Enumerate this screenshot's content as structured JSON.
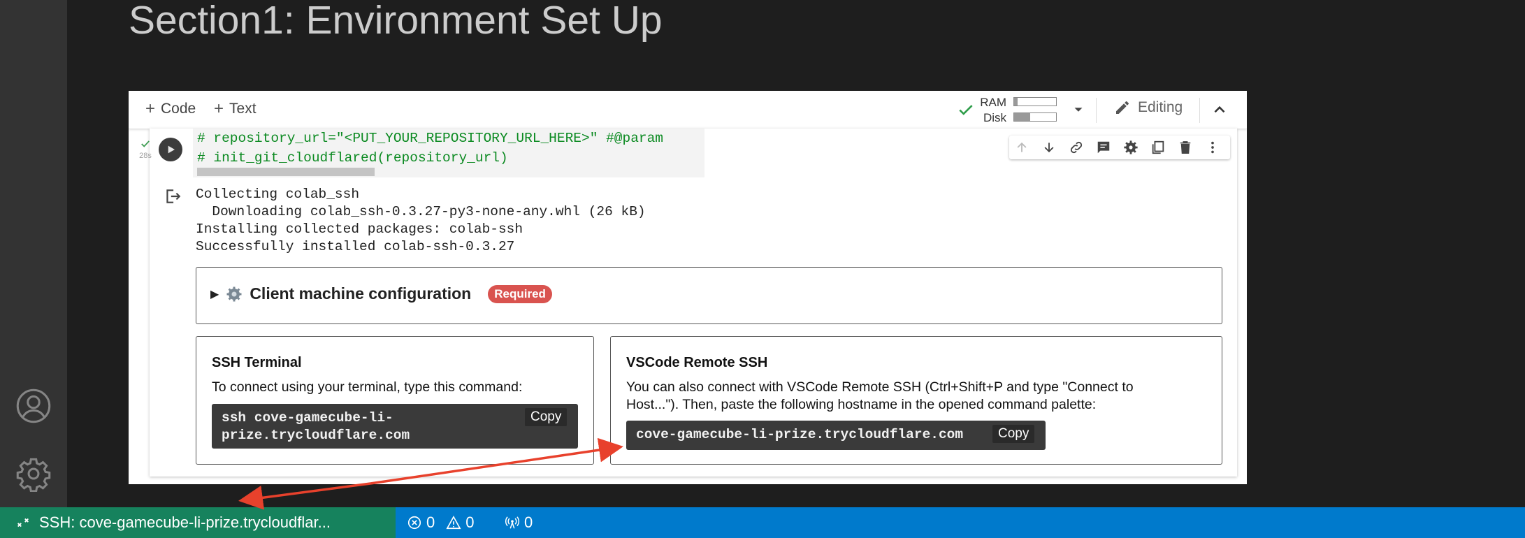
{
  "page": {
    "section_title": "Section1: Environment Set Up"
  },
  "activity_bar": {
    "icons": [
      "account-icon",
      "settings-gear-icon"
    ]
  },
  "colab": {
    "toolbar": {
      "add_code_label": "Code",
      "add_text_label": "Text",
      "ram_label": "RAM",
      "disk_label": "Disk",
      "ram_usage": 0.08,
      "disk_usage": 0.38,
      "editing_label": "Editing"
    },
    "cell": {
      "exec_time": "28s",
      "code_lines": [
        "# repository_url=\"<PUT_YOUR_REPOSITORY_URL_HERE>\" #@param",
        "# init_git_cloudflared(repository_url)"
      ],
      "output_lines": [
        "Collecting colab_ssh",
        "  Downloading colab_ssh-0.3.27-py3-none-any.whl (26 kB)",
        "Installing collected packages: colab-ssh",
        "Successfully installed colab-ssh-0.3.27"
      ],
      "tools": [
        "arrow-up-icon",
        "arrow-down-icon",
        "link-icon",
        "comment-icon",
        "settings-icon",
        "mirror-cell-icon",
        "delete-icon",
        "more-vert-icon"
      ]
    },
    "client_config": {
      "title": "Client machine configuration",
      "badge": "Required"
    },
    "ssh_terminal": {
      "title": "SSH Terminal",
      "description": "To connect using your terminal, type this command:",
      "command_line1": "ssh cove-gamecube-li-",
      "command_line2": "prize.trycloudflare.com",
      "copy_label": "Copy"
    },
    "vscode_remote": {
      "title": "VSCode Remote SSH",
      "description_line1": "You can also connect with VSCode Remote SSH (Ctrl+Shift+P and type \"Connect to",
      "description_line2": "Host...\"). Then, paste the following hostname in the opened command palette:",
      "hostname": "cove-gamecube-li-prize.trycloudflare.com",
      "copy_label": "Copy"
    }
  },
  "statusbar": {
    "remote_label": "SSH: cove-gamecube-li-prize.trycloudflar...",
    "errors": "0",
    "warnings": "0",
    "ports": "0"
  },
  "colors": {
    "statusbar_bg": "#007acc",
    "remote_bg": "#16825d",
    "annotation_arrow": "#e8412c",
    "code_comment": "#0b8a21",
    "required_badge": "#d9534f"
  }
}
